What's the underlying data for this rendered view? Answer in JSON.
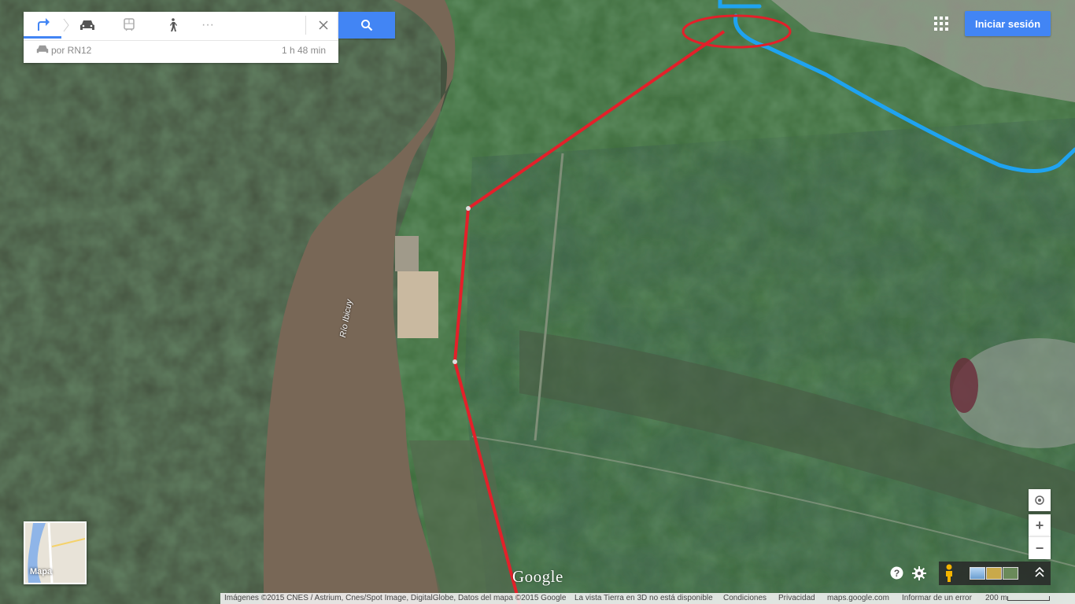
{
  "directions": {
    "modes": [
      {
        "name": "best-route",
        "active": true
      },
      {
        "name": "driving",
        "active": false
      },
      {
        "name": "transit",
        "active": false
      },
      {
        "name": "walking",
        "active": false
      },
      {
        "name": "more",
        "active": false
      }
    ],
    "route_via": "por RN12",
    "route_time": "1 h 48 min"
  },
  "header": {
    "signin_label": "Iniciar sesión"
  },
  "map": {
    "river_label": "Río Ibicuy",
    "map_type_label": "Mapa",
    "google_logo": "Google",
    "zoom_in_label": "+",
    "zoom_out_label": "−",
    "colors": {
      "route_blue": "#1fa3f0",
      "annotation_red": "#e3202a",
      "accent": "#4285f4"
    }
  },
  "footer": {
    "imagery": "Imágenes ©2015 CNES / Astrium, Cnes/Spot Image, DigitalGlobe, Datos del mapa ©2015 Google",
    "earth_3d": "La vista Tierra en 3D no está disponible",
    "conditions": "Condiciones",
    "privacy": "Privacidad",
    "site": "maps.google.com",
    "report": "Informar de un error",
    "scale": "200 m"
  }
}
